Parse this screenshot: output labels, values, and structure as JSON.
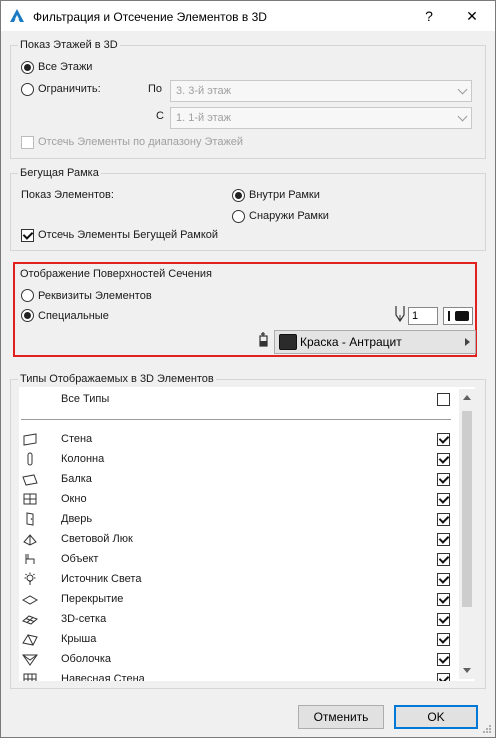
{
  "window": {
    "title": "Фильтрация и Отсечение Элементов в 3D",
    "help_label": "?",
    "close_label": "✕"
  },
  "floors": {
    "group_title": "Показ Этажей в 3D",
    "all_label": "Все Этажи",
    "limit_label": "Ограничить:",
    "to_label": "По",
    "to_value": "3. 3-й этаж",
    "from_label": "С",
    "from_value": "1. 1-й этаж",
    "trim_label": "Отсечь Элементы по диапазону Этажей",
    "selected": "all"
  },
  "marquee": {
    "group_title": "Бегущая Рамка",
    "show_label": "Показ Элементов:",
    "inside_label": "Внутри Рамки",
    "outside_label": "Снаружи Рамки",
    "selected": "inside",
    "trim_label": "Отсечь Элементы Бегущей Рамкой",
    "trim_checked": true
  },
  "cut_surfaces": {
    "group_title": "Отображение Поверхностей Сечения",
    "own_label": "Реквизиты Элементов",
    "uniform_label": "Специальные",
    "selected": "uniform",
    "pen_value": "1",
    "paint_label": "Краска - Антрацит",
    "paint_color": "#2b2b2b",
    "highlight_color": "#e2201e"
  },
  "types": {
    "group_title": "Типы Отображаемых в 3D Элементов",
    "all_label": "Все Типы",
    "all_checked": false,
    "items": [
      {
        "label": "Стена",
        "icon": "wall-icon",
        "checked": true
      },
      {
        "label": "Колонна",
        "icon": "column-icon",
        "checked": true
      },
      {
        "label": "Балка",
        "icon": "beam-icon",
        "checked": true
      },
      {
        "label": "Окно",
        "icon": "window-icon",
        "checked": true
      },
      {
        "label": "Дверь",
        "icon": "door-icon",
        "checked": true
      },
      {
        "label": "Световой Люк",
        "icon": "skylight-icon",
        "checked": true
      },
      {
        "label": "Объект",
        "icon": "object-icon",
        "checked": true
      },
      {
        "label": "Источник Света",
        "icon": "lamp-icon",
        "checked": true
      },
      {
        "label": "Перекрытие",
        "icon": "slab-icon",
        "checked": true
      },
      {
        "label": "3D-сетка",
        "icon": "mesh-icon",
        "checked": true
      },
      {
        "label": "Крыша",
        "icon": "roof-icon",
        "checked": true
      },
      {
        "label": "Оболочка",
        "icon": "shell-icon",
        "checked": true
      },
      {
        "label": "Навесная Стена",
        "icon": "curtain-wall-icon",
        "checked": true
      }
    ]
  },
  "footer": {
    "cancel_label": "Отменить",
    "ok_label": "OK"
  }
}
